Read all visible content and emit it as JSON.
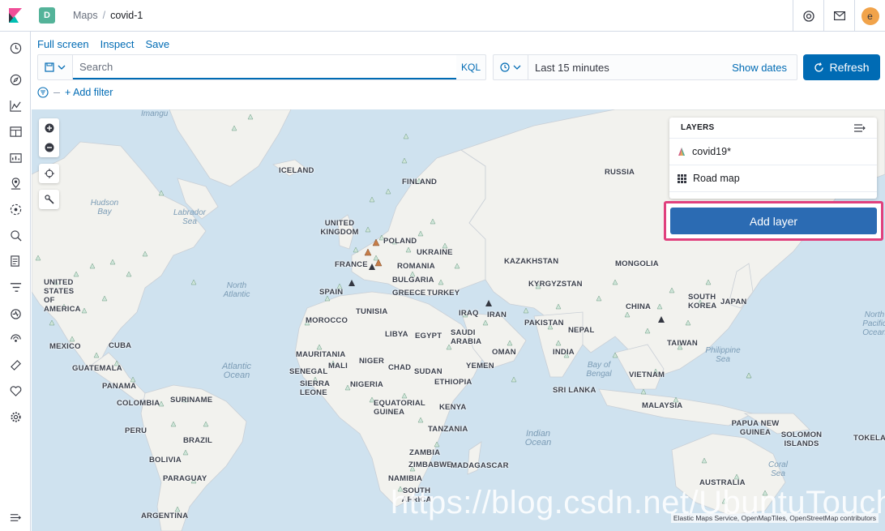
{
  "header": {
    "space_initial": "D",
    "breadcrumbs": [
      "Maps",
      "covid-1"
    ],
    "avatar_initial": "e"
  },
  "actions": {
    "full_screen": "Full screen",
    "inspect": "Inspect",
    "save": "Save"
  },
  "query": {
    "placeholder": "Search",
    "language": "KQL"
  },
  "time": {
    "range": "Last 15 minutes",
    "show_dates": "Show dates",
    "refresh": "Refresh"
  },
  "filters": {
    "add_filter": "+ Add filter"
  },
  "layers_panel": {
    "title": "LAYERS",
    "layers": [
      {
        "name": "covid19*",
        "icon": "marker-icon"
      },
      {
        "name": "Road map",
        "icon": "grid-icon"
      }
    ],
    "add_layer": "Add layer"
  },
  "map": {
    "countries": {
      "iceland": "ICELAND",
      "finland": "FINLAND",
      "russia": "RUSSIA",
      "uk": "UNITED KINGDOM",
      "poland": "POLAND",
      "ukraine": "UKRAINE",
      "france": "FRANCE",
      "romania": "ROMANIA",
      "kazakhstan": "KAZAKHSTAN",
      "mongolia": "MONGOLIA",
      "bulgaria": "BULGARIA",
      "kyrgyzstan": "KYRGYZSTAN",
      "spain": "SPAIN",
      "greece": "GREECE",
      "turkey": "TURKEY",
      "usa": "UNITED STATES OF AMERICA",
      "iraq": "IRAQ",
      "iran": "IRAN",
      "china": "CHINA",
      "south_korea": "SOUTH KOREA",
      "japan": "JAPAN",
      "tunisia": "TUNISIA",
      "morocco": "MOROCCO",
      "libya": "LIBYA",
      "egypt": "EGYPT",
      "saudi": "SAUDI ARABIA",
      "pakistan": "PAKISTAN",
      "nepal": "NEPAL",
      "mexico": "MEXICO",
      "cuba": "CUBA",
      "taiwan": "TAIWAN",
      "mauritania": "MAURITANIA",
      "oman": "OMAN",
      "india": "INDIA",
      "mali": "MALI",
      "niger": "NIGER",
      "chad": "CHAD",
      "sudan": "SUDAN",
      "yemen": "YEMEN",
      "guatemala": "GUATEMALA",
      "senegal": "SENEGAL",
      "nigeria": "NIGERIA",
      "vietnam": "VIETNAM",
      "panama": "PANAMA",
      "ethiopia": "ETHIOPIA",
      "sierra_leone": "SIERRA LEONE",
      "sri_lanka": "SRI LANKA",
      "suriname": "SURINAME",
      "colombia": "COLOMBIA",
      "eq_guinea": "EQUATORIAL GUINEA",
      "kenya": "KENYA",
      "malaysia": "MALAYSIA",
      "peru": "PERU",
      "tanzania": "TANZANIA",
      "brazil": "BRAZIL",
      "png": "PAPUA NEW GUINEA",
      "solomon": "SOLOMON ISLANDS",
      "tokelau": "TOKELAU",
      "zambia": "ZAMBIA",
      "bolivia": "BOLIVIA",
      "zimbabwe": "ZIMBABWE",
      "madagascar": "MADAGASCAR",
      "paraguay": "PARAGUAY",
      "australia": "AUSTRALIA",
      "namibia": "NAMIBIA",
      "south_africa": "SOUTH AFRICA",
      "argentina": "ARGENTINA"
    },
    "oceans": {
      "imangu": "Imangu",
      "hudson": "Hudson Bay",
      "labrador": "Labrador Sea",
      "north_atlantic": "North Atlantic",
      "atlantic": "Atlantic Ocean",
      "bay_bengal": "Bay of Bengal",
      "philippine": "Philippine Sea",
      "north_pacific": "North Pacific Ocean",
      "indian": "Indian Ocean",
      "coral": "Coral Sea"
    },
    "attribution": "Elastic Maps Service, OpenMapTiles, OpenStreetMap contributors",
    "watermark": "https://blog.csdn.net/UbuntuTouch"
  },
  "colors": {
    "primary": "#006bb4",
    "highlight_border": "#e0407d",
    "ocean": "#cfe2ef",
    "land": "#f2f2ee"
  }
}
